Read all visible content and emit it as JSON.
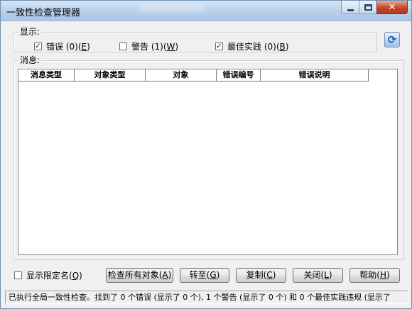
{
  "window": {
    "title": "一致性检查管理器"
  },
  "display_group": {
    "label": "显示:",
    "errors": {
      "prefix": "错误 (0)(",
      "key": "E",
      "suffix": ")",
      "checked": true
    },
    "warnings": {
      "prefix": "警告 (1)(",
      "key": "W",
      "suffix": ")",
      "checked": false
    },
    "best_practices": {
      "prefix": "最佳实践 (0)(",
      "key": "B",
      "suffix": ")",
      "checked": true
    }
  },
  "refresh_icon": "refresh-icon",
  "messages_group": {
    "label": "消息:",
    "columns": [
      "消息类型",
      "对象类型",
      "对象",
      "错误编号",
      "错误说明"
    ]
  },
  "show_qualified_names": {
    "prefix": "显示限定名(",
    "key": "Q",
    "suffix": ")",
    "checked": false
  },
  "buttons": {
    "check_all": {
      "prefix": "检查所有对象(",
      "key": "A",
      "suffix": ")"
    },
    "goto": {
      "prefix": "转至(",
      "key": "G",
      "suffix": ")"
    },
    "copy": {
      "prefix": "复制(",
      "key": "C",
      "suffix": ")"
    },
    "close": {
      "prefix": "关闭(",
      "key": "L",
      "suffix": ")"
    },
    "help": {
      "prefix": "帮助(",
      "key": "H",
      "suffix": ")"
    }
  },
  "status": {
    "text": "已执行全局一致性检查。找到了 0 个错误 (显示了 0 个), 1 个警告 (显示了 0 个) 和 0 个最佳实践违规 (显示了"
  }
}
